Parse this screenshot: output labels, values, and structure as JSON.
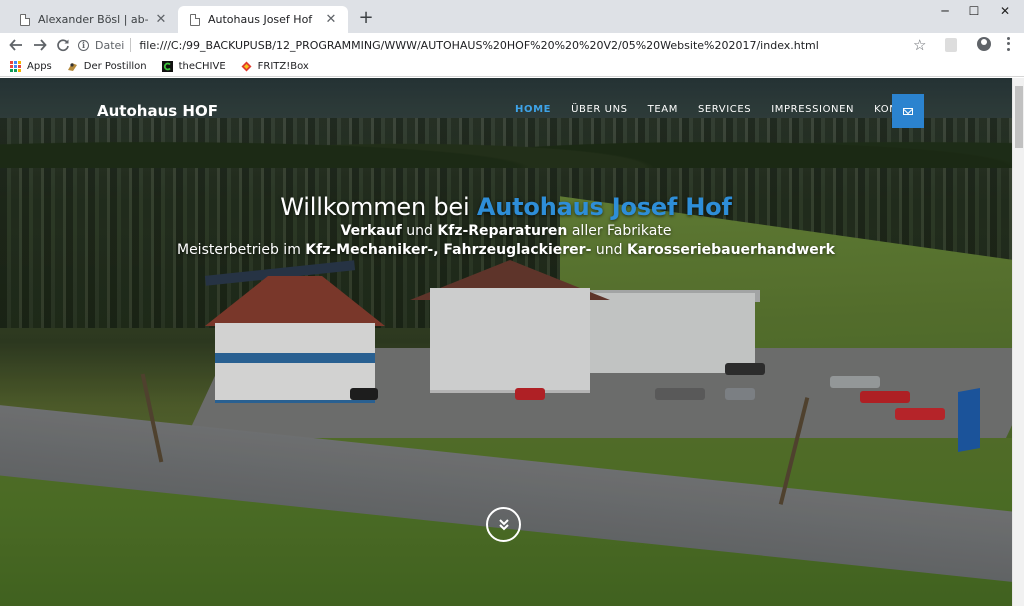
{
  "browser": {
    "tabs": [
      {
        "title": "Alexander Bösl | ab-multimedia.at",
        "active": false
      },
      {
        "title": "Autohaus Josef Hof",
        "active": true
      }
    ],
    "new_tab_label": "+",
    "window_controls": {
      "minimize": "─",
      "maximize": "☐",
      "close": "✕"
    },
    "address_bar": {
      "scheme_label": "Datei",
      "url": "file:///C:/99_BACKUPUSB/12_PROGRAMMING/WWW/AUTOHAUS%20HOF%20%20%20V2/05%20Website%202017/index.html"
    },
    "bookmarks": [
      {
        "label": "Apps",
        "icon": "apps-grid-icon"
      },
      {
        "label": "Der Postillon",
        "icon": "postillon-icon"
      },
      {
        "label": "theCHIVE",
        "icon": "chive-icon"
      },
      {
        "label": "FRITZ!Box",
        "icon": "fritzbox-icon"
      }
    ]
  },
  "site": {
    "brand": "Autohaus HOF",
    "nav": [
      {
        "label": "HOME",
        "active": true
      },
      {
        "label": "ÜBER UNS",
        "active": false
      },
      {
        "label": "TEAM",
        "active": false
      },
      {
        "label": "SERVICES",
        "active": false
      },
      {
        "label": "IMPRESSIONEN",
        "active": false
      },
      {
        "label": "KONTAKT",
        "active": false
      }
    ],
    "mail_icon": "envelope-icon",
    "accent_color": "#2e8ed8",
    "hero": {
      "headline_prefix": "Willkommen bei ",
      "headline_accent": "Autohaus Josef Hof",
      "subline": {
        "part1": "Verkauf",
        "part2": " und ",
        "part3": "Kfz-Reparaturen",
        "part4": " aller Fabrikate"
      },
      "tagline": {
        "part1": "Meisterbetrieb im ",
        "part2": "Kfz-Mechaniker-, Fahrzeuglackierer-",
        "part3": " und ",
        "part4": "Karosseriebauerhandwerk"
      },
      "scroll_icon": "chevron-double-down-icon"
    }
  }
}
